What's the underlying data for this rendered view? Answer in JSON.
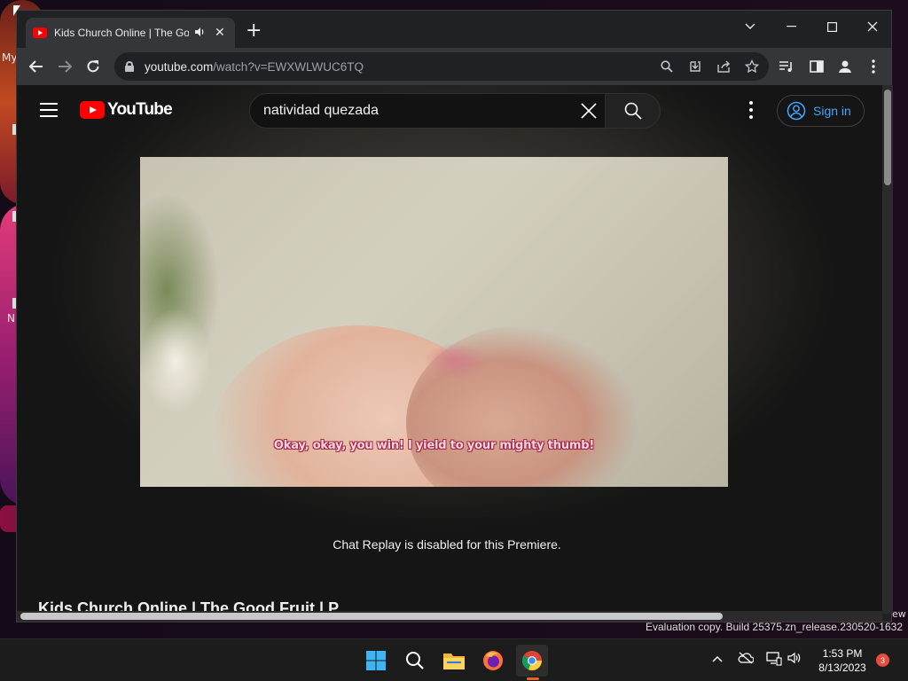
{
  "desktop": {
    "label_partial": "My",
    "label_n": "N",
    "evaluation_text": "Evaluation copy. Build 25375.zn_release.230520-1632",
    "ew_text": "ew"
  },
  "browser": {
    "tab": {
      "title": "Kids Church Online | The Goo",
      "audio_icon": "speaker-icon",
      "close_glyph": "✕"
    },
    "new_tab_glyph": "+",
    "window_controls": {
      "dropdown": "⌄",
      "minimize": "—",
      "maximize": "☐",
      "close": "✕"
    },
    "address": {
      "domain": "youtube.com",
      "path": "/watch?v=EWXWLWUC6TQ"
    }
  },
  "youtube": {
    "logo_text": "YouTube",
    "search": {
      "value": "natividad quezada",
      "placeholder": "Search"
    },
    "sign_in_label": "Sign in",
    "caption": "Okay, okay, you win! I yield to your mighty thumb!",
    "chat_replay": "Chat Replay is disabled for this Premiere.",
    "video_title_partial": "Kids Church Online | The Good Fruit | P"
  },
  "taskbar": {
    "time": "1:53 PM",
    "date": "8/13/2023",
    "notifications": "3",
    "apps": [
      "start-icon",
      "search-icon",
      "file-explorer-icon",
      "firefox-icon",
      "chrome-icon"
    ]
  },
  "colors": {
    "youtube_red": "#ff0000",
    "link_blue": "#3ea6ff",
    "chrome_dark": "#202124",
    "toolbar": "#35363a"
  }
}
